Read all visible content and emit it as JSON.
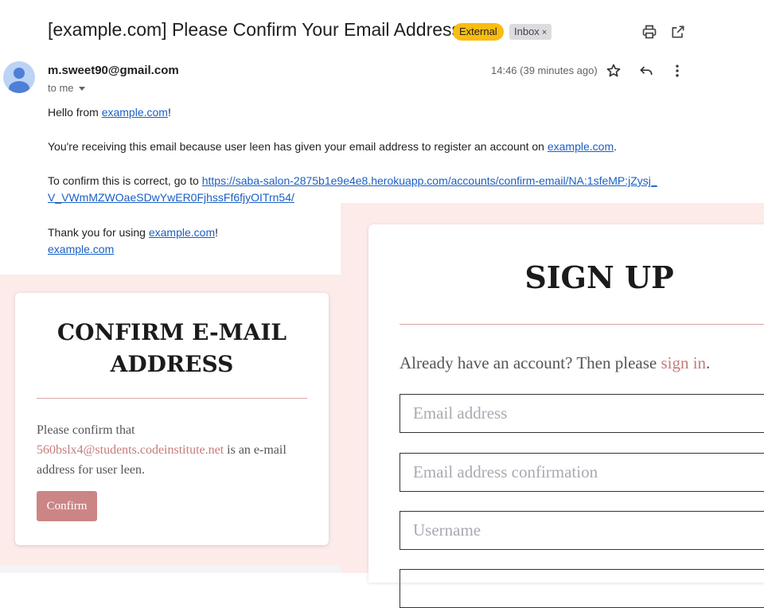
{
  "email": {
    "subject": "[example.com] Please Confirm Your Email Address",
    "labels": {
      "external": "External",
      "inbox": "Inbox",
      "inbox_remove": "×"
    },
    "sender": "m.sweet90@gmail.com",
    "to": "to me",
    "timestamp": "14:46 (39 minutes ago)",
    "icons": [
      "print-icon",
      "open-in-new-window-icon",
      "star-icon",
      "reply-icon",
      "more-vert-icon",
      "avatar-icon"
    ],
    "body": {
      "greeting_prefix": "Hello from ",
      "greeting_link": "example.com",
      "greeting_suffix": "!",
      "reason_prefix": "You're receiving this email because user leen has given your email address to register an account on ",
      "reason_link": "example.com",
      "reason_suffix": ".",
      "confirm_prefix": "To confirm this is correct, go to ",
      "confirm_link_line1": "https://saba-salon-2875b1e9e4e8.herokuapp.com/accounts/confirm-email/NA:1sfeMP:jZysj_",
      "confirm_link_line2": "V_VWmMZWOaeSDwYwER0FjhssFf6fjyOITrn54/",
      "thanks_prefix": "Thank you for using ",
      "thanks_link": "example.com",
      "thanks_suffix": "!",
      "signature_link": "example.com"
    }
  },
  "confirm_page": {
    "title_line1": "CONFIRM E-MAIL",
    "title_line2": "ADDRESS",
    "text_prefix": "Please confirm that",
    "email": "560bslx4@students.codeinstitute.net",
    "text_suffix": " is an e-mail address for user leen.",
    "button": "Confirm"
  },
  "signup_page": {
    "title": "SIGN UP",
    "signin_prefix": "Already have an account? Then please ",
    "signin_link": "sign in",
    "signin_suffix": ".",
    "fields": {
      "email_placeholder": "Email address",
      "email_confirm_placeholder": "Email address confirmation",
      "username_placeholder": "Username"
    }
  },
  "colors": {
    "external_badge": "#f9bc0f",
    "link_blue": "#1a5fc4",
    "page_bg_pink": "#fdebea",
    "accent_rose": "#cc8585"
  }
}
